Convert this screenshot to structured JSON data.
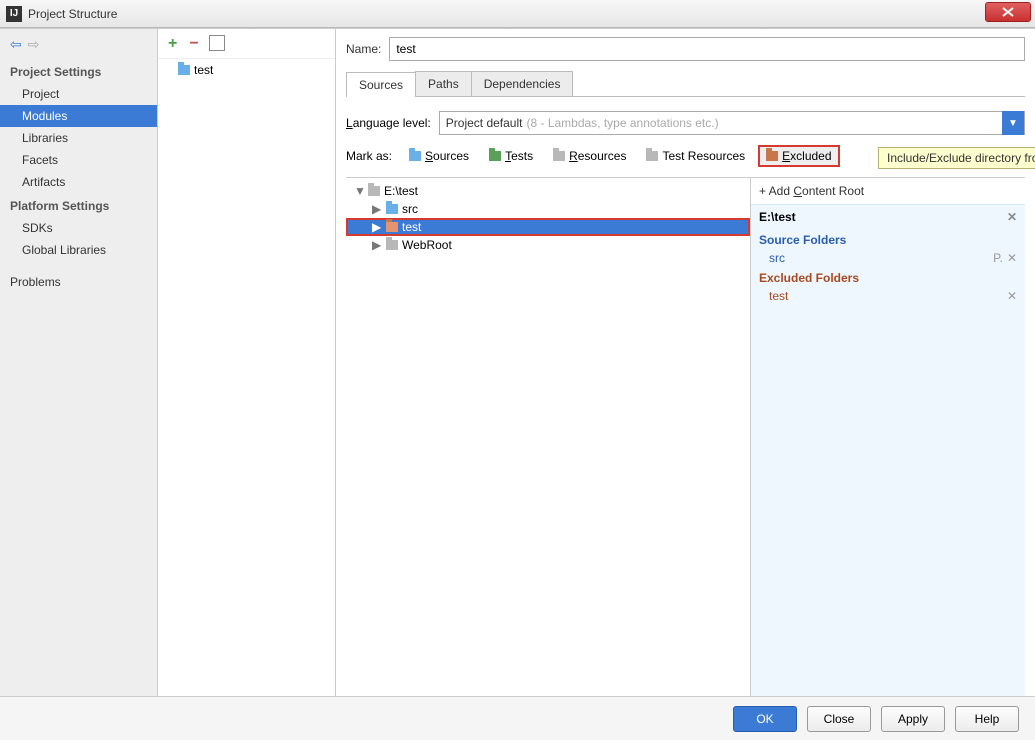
{
  "window": {
    "title": "Project Structure"
  },
  "sidebar": {
    "section1": "Project Settings",
    "items1": [
      "Project",
      "Modules",
      "Libraries",
      "Facets",
      "Artifacts"
    ],
    "section2": "Platform Settings",
    "items2": [
      "SDKs",
      "Global Libraries"
    ],
    "problems": "Problems"
  },
  "modules": {
    "item": "test"
  },
  "main": {
    "name_label": "Name:",
    "name_value": "test",
    "tabs": [
      "Sources",
      "Paths",
      "Dependencies"
    ],
    "lang_label": "Language level:",
    "lang_value": "Project default",
    "lang_hint": "(8 - Lambdas, type annotations etc.)",
    "tooltip": "Include/Exclude directory from module (Alt+E)",
    "markas_label": "Mark as:",
    "mark_buttons": {
      "sources": "Sources",
      "tests": "Tests",
      "resources": "Resources",
      "test_resources": "Test Resources",
      "excluded": "Excluded"
    },
    "tree": {
      "root": "E:\\test",
      "children": [
        "src",
        "test",
        "WebRoot"
      ]
    },
    "roots": {
      "add": "+ Add Content Root",
      "path": "E:\\test",
      "source_h": "Source Folders",
      "source_items": [
        "src"
      ],
      "excluded_h": "Excluded Folders",
      "excluded_items": [
        "test"
      ]
    }
  },
  "buttons": {
    "ok": "OK",
    "cancel": "Close",
    "apply": "Apply",
    "help": "Help"
  }
}
